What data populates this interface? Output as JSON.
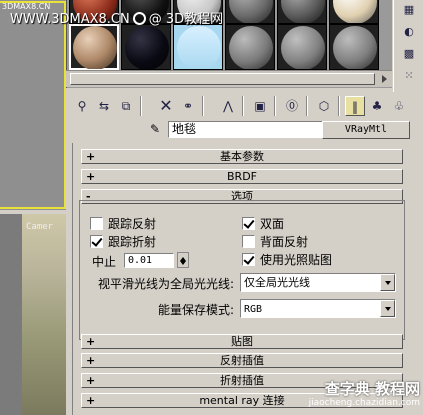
{
  "watermark": {
    "site": "WWW.3DMAX8.CN",
    "sep": "@",
    "title": "3D教程网",
    "corner_logo": "3DMAX8.CN"
  },
  "viewport": {
    "label": "Camer"
  },
  "slots": {
    "row1": [
      "#8a2a1a",
      "#101010",
      "#c8c8c8",
      "#6a6a6a",
      "#5a5a5a",
      "#e0d0b0"
    ],
    "row2": [
      "#b08a6a",
      "#0a0a14",
      "#a8d8f0",
      "#7a7a7a",
      "#808080",
      "#7e7e7e"
    ]
  },
  "material": {
    "name": "地毯",
    "type_button": "VRayMtl"
  },
  "rollouts": {
    "basic": {
      "sign": "+",
      "label": "基本参数"
    },
    "brdf": {
      "sign": "+",
      "label": "BRDF"
    },
    "options": {
      "sign": "-",
      "label": "选项"
    },
    "maps": {
      "sign": "+",
      "label": "贴图"
    },
    "refl_interp": {
      "sign": "+",
      "label": "反射插值"
    },
    "refr_interp": {
      "sign": "+",
      "label": "折射插值"
    },
    "mental_ray": {
      "sign": "+",
      "label": "mental ray 连接"
    }
  },
  "options": {
    "trace_reflections": {
      "label": "跟踪反射",
      "checked": false
    },
    "double_sided": {
      "label": "双面",
      "checked": true
    },
    "trace_refractions": {
      "label": "跟踪折射",
      "checked": true
    },
    "reflect_backside": {
      "label": "背面反射",
      "checked": false
    },
    "cutoff_label": "中止",
    "cutoff_value": "0.01",
    "use_irradiance": {
      "label": "使用光照贴图",
      "checked": true
    },
    "glossy_rays_label": "视平滑光线为全局光光线:",
    "glossy_rays_value": "仅全局光光线",
    "energy_label": "能量保存模式:",
    "energy_value": "RGB"
  },
  "corner_watermark": {
    "big": "查字典 教程网",
    "url": "jiaocheng.chazidian.com"
  }
}
